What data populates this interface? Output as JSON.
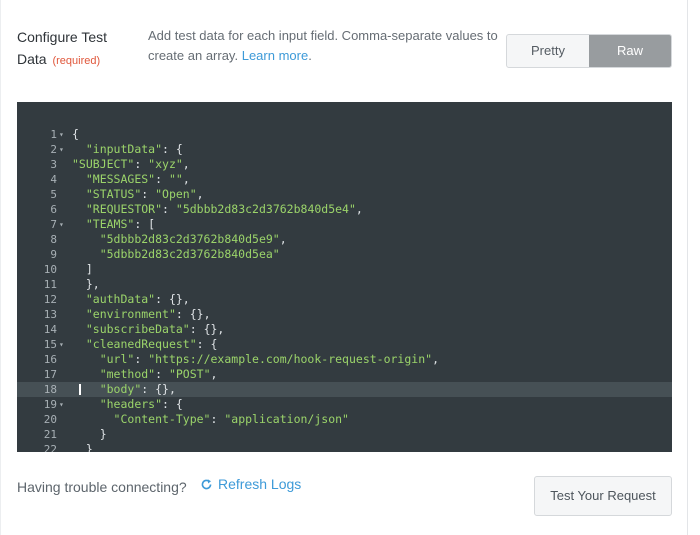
{
  "header": {
    "title": "Configure Test Data",
    "required": "(required)",
    "description": "Add test data for each input field. Comma-separate values to create an array.",
    "learn_more": "Learn more",
    "period": "."
  },
  "toggle": {
    "pretty": "Pretty",
    "raw": "Raw",
    "active": "Raw"
  },
  "editor": {
    "lines": [
      {
        "n": "1",
        "fold": true,
        "indent": 0,
        "text": "{"
      },
      {
        "n": "2",
        "fold": true,
        "indent": 2,
        "key": "\"inputData\"",
        "rest": ": {"
      },
      {
        "n": "3",
        "fold": false,
        "indent": 0,
        "key": "\"SUBJECT\"",
        "rest": ": ",
        "val": "\"xyz\"",
        "tail": ","
      },
      {
        "n": "4",
        "fold": false,
        "indent": 2,
        "key": "\"MESSAGES\"",
        "rest": ": ",
        "val": "\"\"",
        "tail": ","
      },
      {
        "n": "5",
        "fold": false,
        "indent": 2,
        "key": "\"STATUS\"",
        "rest": ": ",
        "val": "\"Open\"",
        "tail": ","
      },
      {
        "n": "6",
        "fold": false,
        "indent": 2,
        "key": "\"REQUESTOR\"",
        "rest": ": ",
        "val": "\"5dbbb2d83c2d3762b840d5e4\"",
        "tail": ","
      },
      {
        "n": "7",
        "fold": true,
        "indent": 2,
        "key": "\"TEAMS\"",
        "rest": ": ["
      },
      {
        "n": "8",
        "fold": false,
        "indent": 4,
        "val": "\"5dbbb2d83c2d3762b840d5e9\"",
        "tail": ","
      },
      {
        "n": "9",
        "fold": false,
        "indent": 4,
        "val": "\"5dbbb2d83c2d3762b840d5ea\""
      },
      {
        "n": "10",
        "fold": false,
        "indent": 2,
        "text": "]"
      },
      {
        "n": "11",
        "fold": false,
        "indent": 2,
        "text": "},"
      },
      {
        "n": "12",
        "fold": false,
        "indent": 2,
        "key": "\"authData\"",
        "rest": ": {},"
      },
      {
        "n": "13",
        "fold": false,
        "indent": 2,
        "key": "\"environment\"",
        "rest": ": {},"
      },
      {
        "n": "14",
        "fold": false,
        "indent": 2,
        "key": "\"subscribeData\"",
        "rest": ": {},"
      },
      {
        "n": "15",
        "fold": true,
        "indent": 2,
        "key": "\"cleanedRequest\"",
        "rest": ": {"
      },
      {
        "n": "16",
        "fold": false,
        "indent": 4,
        "key": "\"url\"",
        "rest": ": ",
        "val": "\"https://example.com/hook-request-origin\"",
        "tail": ","
      },
      {
        "n": "17",
        "fold": false,
        "indent": 4,
        "key": "\"method\"",
        "rest": ": ",
        "val": "\"POST\"",
        "tail": ","
      },
      {
        "n": "18",
        "fold": false,
        "indent": 4,
        "key": "\"body\"",
        "rest": ": {},",
        "active": true
      },
      {
        "n": "19",
        "fold": true,
        "indent": 4,
        "key": "\"headers\"",
        "rest": ": {"
      },
      {
        "n": "20",
        "fold": false,
        "indent": 6,
        "key": "\"Content-Type\"",
        "rest": ": ",
        "val": "\"application/json\""
      },
      {
        "n": "21",
        "fold": false,
        "indent": 4,
        "text": "}"
      },
      {
        "n": "22",
        "fold": false,
        "indent": 2,
        "text": "}"
      }
    ]
  },
  "footer": {
    "trouble_text": "Having trouble connecting?",
    "refresh_label": "Refresh Logs",
    "test_button": "Test Your Request"
  },
  "colors": {
    "link": "#3d9ad8",
    "required": "#e0573b",
    "editor_bg": "#333b40",
    "string": "#9bd46a"
  }
}
